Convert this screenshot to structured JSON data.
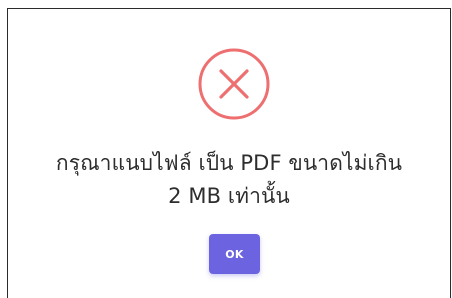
{
  "dialog": {
    "icon": "error-x-circle-icon",
    "message_line1": "กรุณาแนบไฟล์ เป็น PDF ขนาดไม่เกิน",
    "message_line2": "2 MB เท่านั้น",
    "ok_label": "OK"
  },
  "colors": {
    "error_icon": "#ee6f6f",
    "button": "#6b63df",
    "text": "#2d2d2d"
  }
}
